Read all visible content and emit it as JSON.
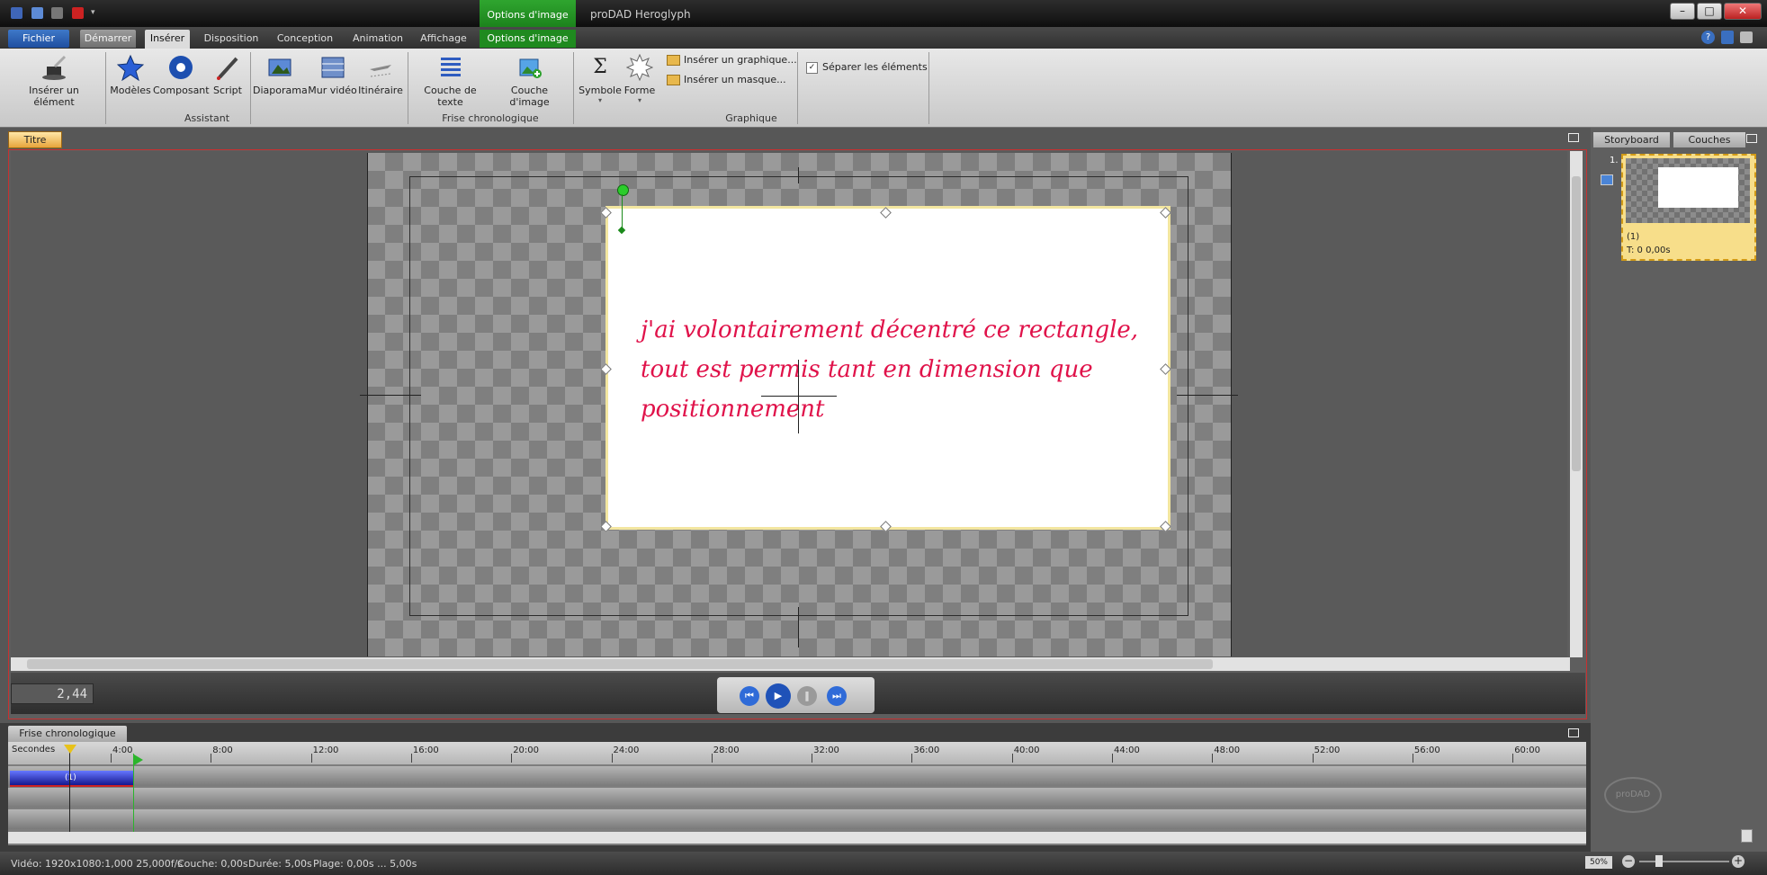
{
  "app": {
    "title": "proDAD Heroglyph"
  },
  "context_tab": {
    "header": "Options d'image"
  },
  "tabs": [
    "Fichier",
    "Démarrer",
    "Insérer",
    "Disposition",
    "Conception",
    "Animation",
    "Affichage",
    "Options d'image"
  ],
  "ribbon": {
    "buttons": {
      "inserer_element": "Insérer un élément",
      "modeles": "Modèles",
      "composant": "Composant",
      "script": "Script",
      "diaporama": "Diaporama",
      "mur_video": "Mur vidéo",
      "itineraire": "Itinéraire",
      "couche_texte": "Couche de texte",
      "couche_image": "Couche d'image",
      "symbole": "Symbole",
      "forme": "Forme",
      "inserer_graphique": "Insérer un graphique...",
      "inserer_masque": "Insérer un masque...",
      "separer": "Séparer les éléments"
    },
    "groups": {
      "assistant": "Assistant",
      "frise": "Frise chronologique",
      "graphique": "Graphique"
    }
  },
  "editor": {
    "tab": "Titre",
    "text_lines": [
      "j'ai volontairement décentré ce rectangle,",
      "tout est permis tant en dimension que",
      "positionnement"
    ],
    "timecode": "2,44"
  },
  "right_panel": {
    "tabs": {
      "storyboard": "Storyboard",
      "couches": "Couches"
    },
    "card": {
      "index": "1.",
      "name": "(1)",
      "time": "T: 0  0,00s"
    }
  },
  "timeline": {
    "tab": "Frise chronologique",
    "unit_label": "Secondes",
    "ticks": [
      "4:00",
      "8:00",
      "12:00",
      "16:00",
      "20:00",
      "24:00",
      "28:00",
      "32:00",
      "36:00",
      "40:00",
      "44:00",
      "48:00",
      "52:00",
      "56:00",
      "60:00"
    ],
    "clip_label": "(1)"
  },
  "status": {
    "video": "Vidéo: 1920x1080:1,000  25,000f/s",
    "couche": "Couche: 0,00s",
    "duree": "Durée: 5,00s",
    "plage": "Plage: 0,00s ... 5,00s",
    "zoom": "50%"
  },
  "colors": {
    "accent": "#1f8a1f",
    "text": "#e0124a",
    "selection": "#d29a16"
  }
}
